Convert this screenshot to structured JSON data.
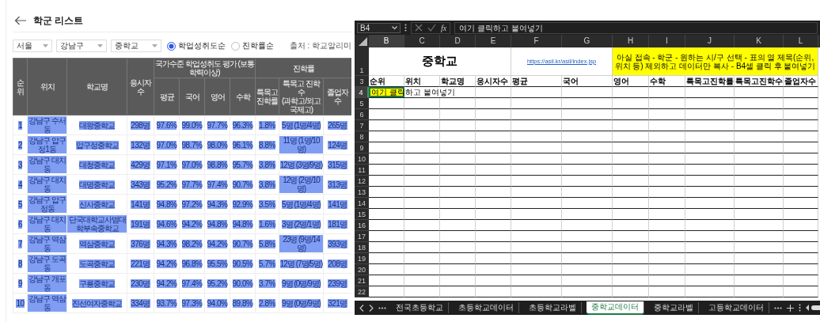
{
  "school_list": {
    "title": "학군 리스트",
    "filters": [
      {
        "value": "서울"
      },
      {
        "value": "강남구"
      },
      {
        "value": "중학교"
      }
    ],
    "sort_options": [
      {
        "label": "학업성취도순",
        "selected": true
      },
      {
        "label": "진학률순",
        "selected": false
      }
    ],
    "source": "출처 : 학교알리미",
    "table": {
      "text_selected": true,
      "ungrouped_columns": [
        {
          "label": "순위"
        },
        {
          "label": "위치"
        },
        {
          "label": "학교명"
        },
        {
          "label": "응시자수"
        }
      ],
      "column_groups": [
        {
          "label": "국가수준 학업성취도 평가 (보통학력이상)",
          "columns": [
            {
              "label": "평균"
            },
            {
              "label": "국어"
            },
            {
              "label": "영어"
            },
            {
              "label": "수학"
            }
          ]
        },
        {
          "label": "진학률",
          "columns": [
            {
              "label": "특목고 진학률"
            },
            {
              "label": "특목고 진학수",
              "note": "(과학고/외고국제고)"
            },
            {
              "label": "졸업자 수"
            }
          ]
        }
      ],
      "rows": [
        [
          "1",
          "강남구 수서동",
          "대왕중학교",
          "298명",
          "97.6%",
          "99.0%",
          "97.7%",
          "96.3%",
          "1.8%",
          "5명 (1명/4명)",
          "265명"
        ],
        [
          "2",
          "강남구 압구정1동",
          "압구정중학교",
          "132명",
          "97.0%",
          "98.7%",
          "98.0%",
          "96.1%",
          "8.8%",
          "11명 (1명/10명)",
          "124명"
        ],
        [
          "3",
          "강남구 대치동",
          "대청중학교",
          "429명",
          "97.1%",
          "97.0%",
          "98.8%",
          "95.7%",
          "3.8%",
          "12명 (3명/9명)",
          "315명"
        ],
        [
          "4",
          "강남구 대치동",
          "대명중학교",
          "343명",
          "95.2%",
          "97.7%",
          "97.4%",
          "90.7%",
          "3.8%",
          "12명 (2명/10명)",
          "313명"
        ],
        [
          "5",
          "강남구 압구정동",
          "신사중학교",
          "141명",
          "94.8%",
          "97.2%",
          "94.3%",
          "92.9%",
          "3.5%",
          "5명 (1명/4명)",
          "141명"
        ],
        [
          "6",
          "강남구 대치동",
          "단국대학교사범대학부속중학교",
          "191명",
          "94.6%",
          "94.2%",
          "94.8%",
          "94.8%",
          "1.6%",
          "3명 (2명/1명)",
          "181명"
        ],
        [
          "7",
          "강남구 역삼동",
          "역삼중학교",
          "376명",
          "94.3%",
          "98.2%",
          "94.2%",
          "90.7%",
          "5.8%",
          "23명 (9명/14명)",
          "393명"
        ],
        [
          "8",
          "강남구 도곡동",
          "도곡중학교",
          "221명",
          "94.2%",
          "96.8%",
          "95.5%",
          "90.5%",
          "5.7%",
          "12명 (7명/5명)",
          "208명"
        ],
        [
          "9",
          "강남구 개포동",
          "구룡중학교",
          "230명",
          "94.2%",
          "97.4%",
          "95.2%",
          "90.0%",
          "3.7%",
          "9명 (0명/9명)",
          "239명"
        ],
        [
          "10",
          "강남구 역삼동",
          "진선여자중학교",
          "334명",
          "93.7%",
          "97.3%",
          "94.0%",
          "89.8%",
          "2.8%",
          "9명 (0명/9명)",
          "321명"
        ]
      ]
    }
  },
  "spreadsheet": {
    "name_box": "B4",
    "fx_label": "fx",
    "formula": "여기 클릭하고 붙여넣기",
    "column_headers": [
      {
        "label": "B",
        "selected": true
      },
      {
        "label": "C",
        "selected": false
      },
      {
        "label": "D",
        "selected": false
      },
      {
        "label": "E",
        "selected": false
      },
      {
        "label": "F",
        "selected": false
      },
      {
        "label": "G",
        "selected": false
      },
      {
        "label": "H",
        "selected": false
      },
      {
        "label": "I",
        "selected": false
      },
      {
        "label": "J",
        "selected": false
      },
      {
        "label": "K",
        "selected": false
      },
      {
        "label": "L",
        "selected": false
      }
    ],
    "row_numbers": [
      {
        "label": "1",
        "selected": false
      },
      {
        "label": "3",
        "selected": false
      },
      {
        "label": "4",
        "selected": true
      },
      {
        "label": "5",
        "selected": false
      },
      {
        "label": "6",
        "selected": false
      },
      {
        "label": "7",
        "selected": false
      },
      {
        "label": "8",
        "selected": false
      },
      {
        "label": "9",
        "selected": false
      },
      {
        "label": "10",
        "selected": false
      },
      {
        "label": "11",
        "selected": false
      },
      {
        "label": "12",
        "selected": false
      },
      {
        "label": "13",
        "selected": false
      },
      {
        "label": "14",
        "selected": false
      },
      {
        "label": "15",
        "selected": false
      },
      {
        "label": "16",
        "selected": false
      },
      {
        "label": "17",
        "selected": false
      },
      {
        "label": "18",
        "selected": false
      },
      {
        "label": "19",
        "selected": false
      },
      {
        "label": "20",
        "selected": false
      },
      {
        "label": "21",
        "selected": false
      },
      {
        "label": "22",
        "selected": false
      }
    ],
    "title_cell": "중학교",
    "link": "https://asil.kr/asil/index.jsp",
    "note": "아실 접속 - 학군 - 원하는 시/구 선택 - 표의 열 제목(순위, 위치 등) 제외하고 데이터만 복사 - B4셀 클릭 후 붙여넣기",
    "header_row": [
      "순위",
      "위치",
      "학교명",
      "응시자수",
      "평균",
      "국어",
      "영어",
      "수학",
      "특목고진학률",
      "특목고진학수",
      "졸업자수"
    ],
    "active_cell": "여기 클릭하고 붙여넣기",
    "sheet_tabs": [
      {
        "label": "전국초등학교",
        "selected": false
      },
      {
        "label": "초등학교데이터",
        "selected": false
      },
      {
        "label": "초등학교라벨",
        "selected": false
      },
      {
        "label": "중학교데이터",
        "selected": true
      },
      {
        "label": "중학교라벨",
        "selected": false
      },
      {
        "label": "고등학교데이터",
        "selected": false
      }
    ]
  }
}
